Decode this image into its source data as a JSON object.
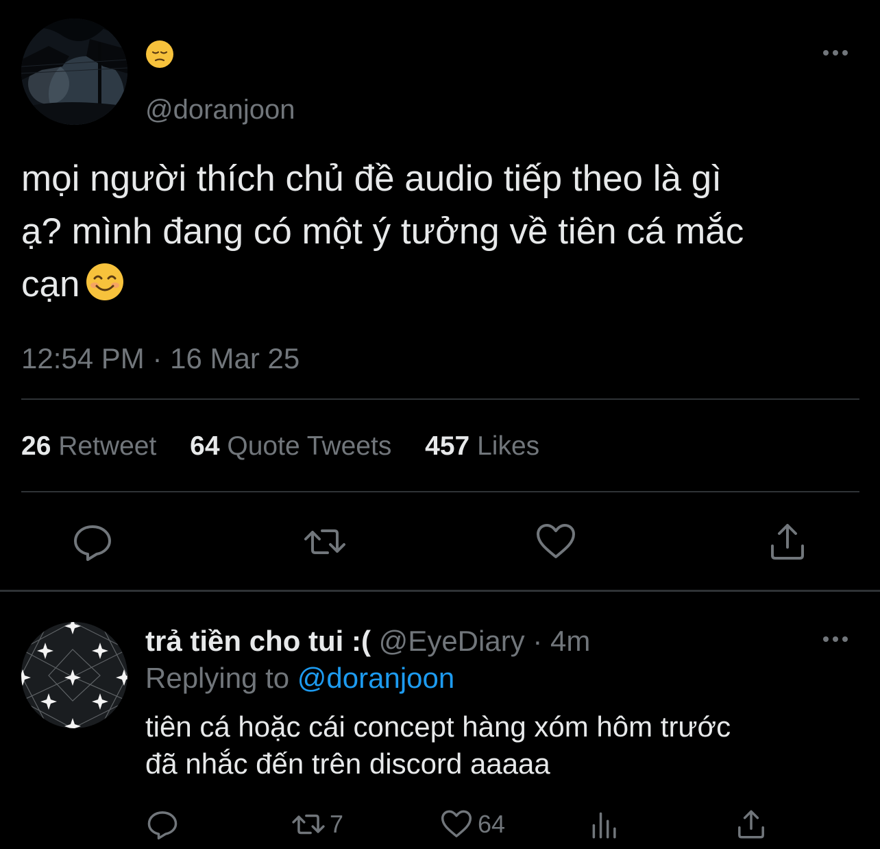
{
  "tweet": {
    "display_emoji": "😔",
    "handle": "@doranjoon",
    "text_lines": [
      "mọi người thích chủ đề audio tiếp theo là gì",
      "ạ? mình đang có một ý tưởng về tiên cá mắc",
      "cạn"
    ],
    "text_emoji": "😊",
    "timestamp": "12:54 PM · 16 Mar 25",
    "stats": {
      "retweets": "26",
      "retweets_label": "Retweet",
      "quotes": "64",
      "quotes_label": "Quote Tweets",
      "likes": "457",
      "likes_label": "Likes"
    },
    "actions": [
      "reply-icon",
      "retweet-icon",
      "like-icon",
      "share-icon"
    ]
  },
  "reply": {
    "name": "trả tiền cho tui :(",
    "handle": "@EyeDiary",
    "separator": "·",
    "time": "4m",
    "replying_to_label": "Replying to",
    "replying_to_handle": "@doranjoon",
    "text_lines": [
      "tiên cá hoặc cái concept hàng xóm hôm trước",
      "đã nhắc đến trên discord aaaaa"
    ],
    "retweet_count": "7",
    "like_count": "64",
    "actions": [
      "reply-icon",
      "retweet-icon",
      "like-icon",
      "analytics-icon",
      "share-icon"
    ]
  },
  "colors": {
    "background": "#000000",
    "text_primary": "#e7e9ea",
    "text_secondary": "#71767b",
    "accent": "#1d9bf0",
    "divider": "#2f3336"
  }
}
